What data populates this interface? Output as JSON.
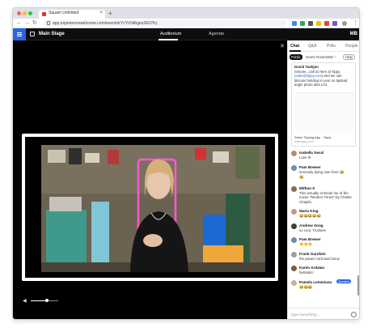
{
  "browser": {
    "tab_title": "Squam Unfolded",
    "new_tab": "+",
    "tab_close": "×",
    "url": "app.experiencewelcome.com/events/rYcYrOdbges2E07fry",
    "colors": {
      "close": "#ff5f57",
      "min": "#febc2e",
      "max": "#28c840"
    }
  },
  "app": {
    "title": "Main Stage",
    "tabs": [
      "Auditorium",
      "Agenda"
    ],
    "active_tab": "Auditorium",
    "user_initials": "MB",
    "accent": "#2a63e6"
  },
  "panel": {
    "tabs": [
      "Chat",
      "Q&A",
      "Polls",
      "People"
    ],
    "active_tab": "Chat",
    "filters": [
      "Public",
      "Green Room",
      "DMs",
      "Help"
    ],
    "active_filter": "Public",
    "dm_badge": "1",
    "pinned": {
      "name": "David Taskjan",
      "text_before": "Simone...call us here at Tippy ",
      "link": "(sales@tippy.com",
      "text_after": ") and we can discuss building in your no tipdsad angle photo idea LOL",
      "card_title": "Salon Tipping App · Tippy",
      "card_url": "www.tippy.com"
    },
    "messages": [
      {
        "name": "Isabella Secal",
        "text": "Love it!"
      },
      {
        "name": "Pam Brewer",
        "text": "seriously dying over here 😂",
        "extra": "😂"
      },
      {
        "name": "Mithun K",
        "text": "This actually reminds me of the movie \"Modern Times\" by Charlie Chaplin."
      },
      {
        "name": "Maria King",
        "text": "😂😂😂😂😂"
      },
      {
        "name": "Andrew Song",
        "text": "so cool, Truckee!"
      },
      {
        "name": "Pam Brewer",
        "text": "👏👏👏"
      },
      {
        "name": "Frank Garofalo",
        "text": "the power cord was funny"
      },
      {
        "name": "Karim Ardalan",
        "text": "fantastic!"
      },
      {
        "name": "Pamela Lemmiano",
        "badge": "Speaker",
        "text": "😂😂😂"
      }
    ],
    "composer_placeholder": "Type something..."
  },
  "stage": {
    "video_icon": "person-on-video"
  }
}
